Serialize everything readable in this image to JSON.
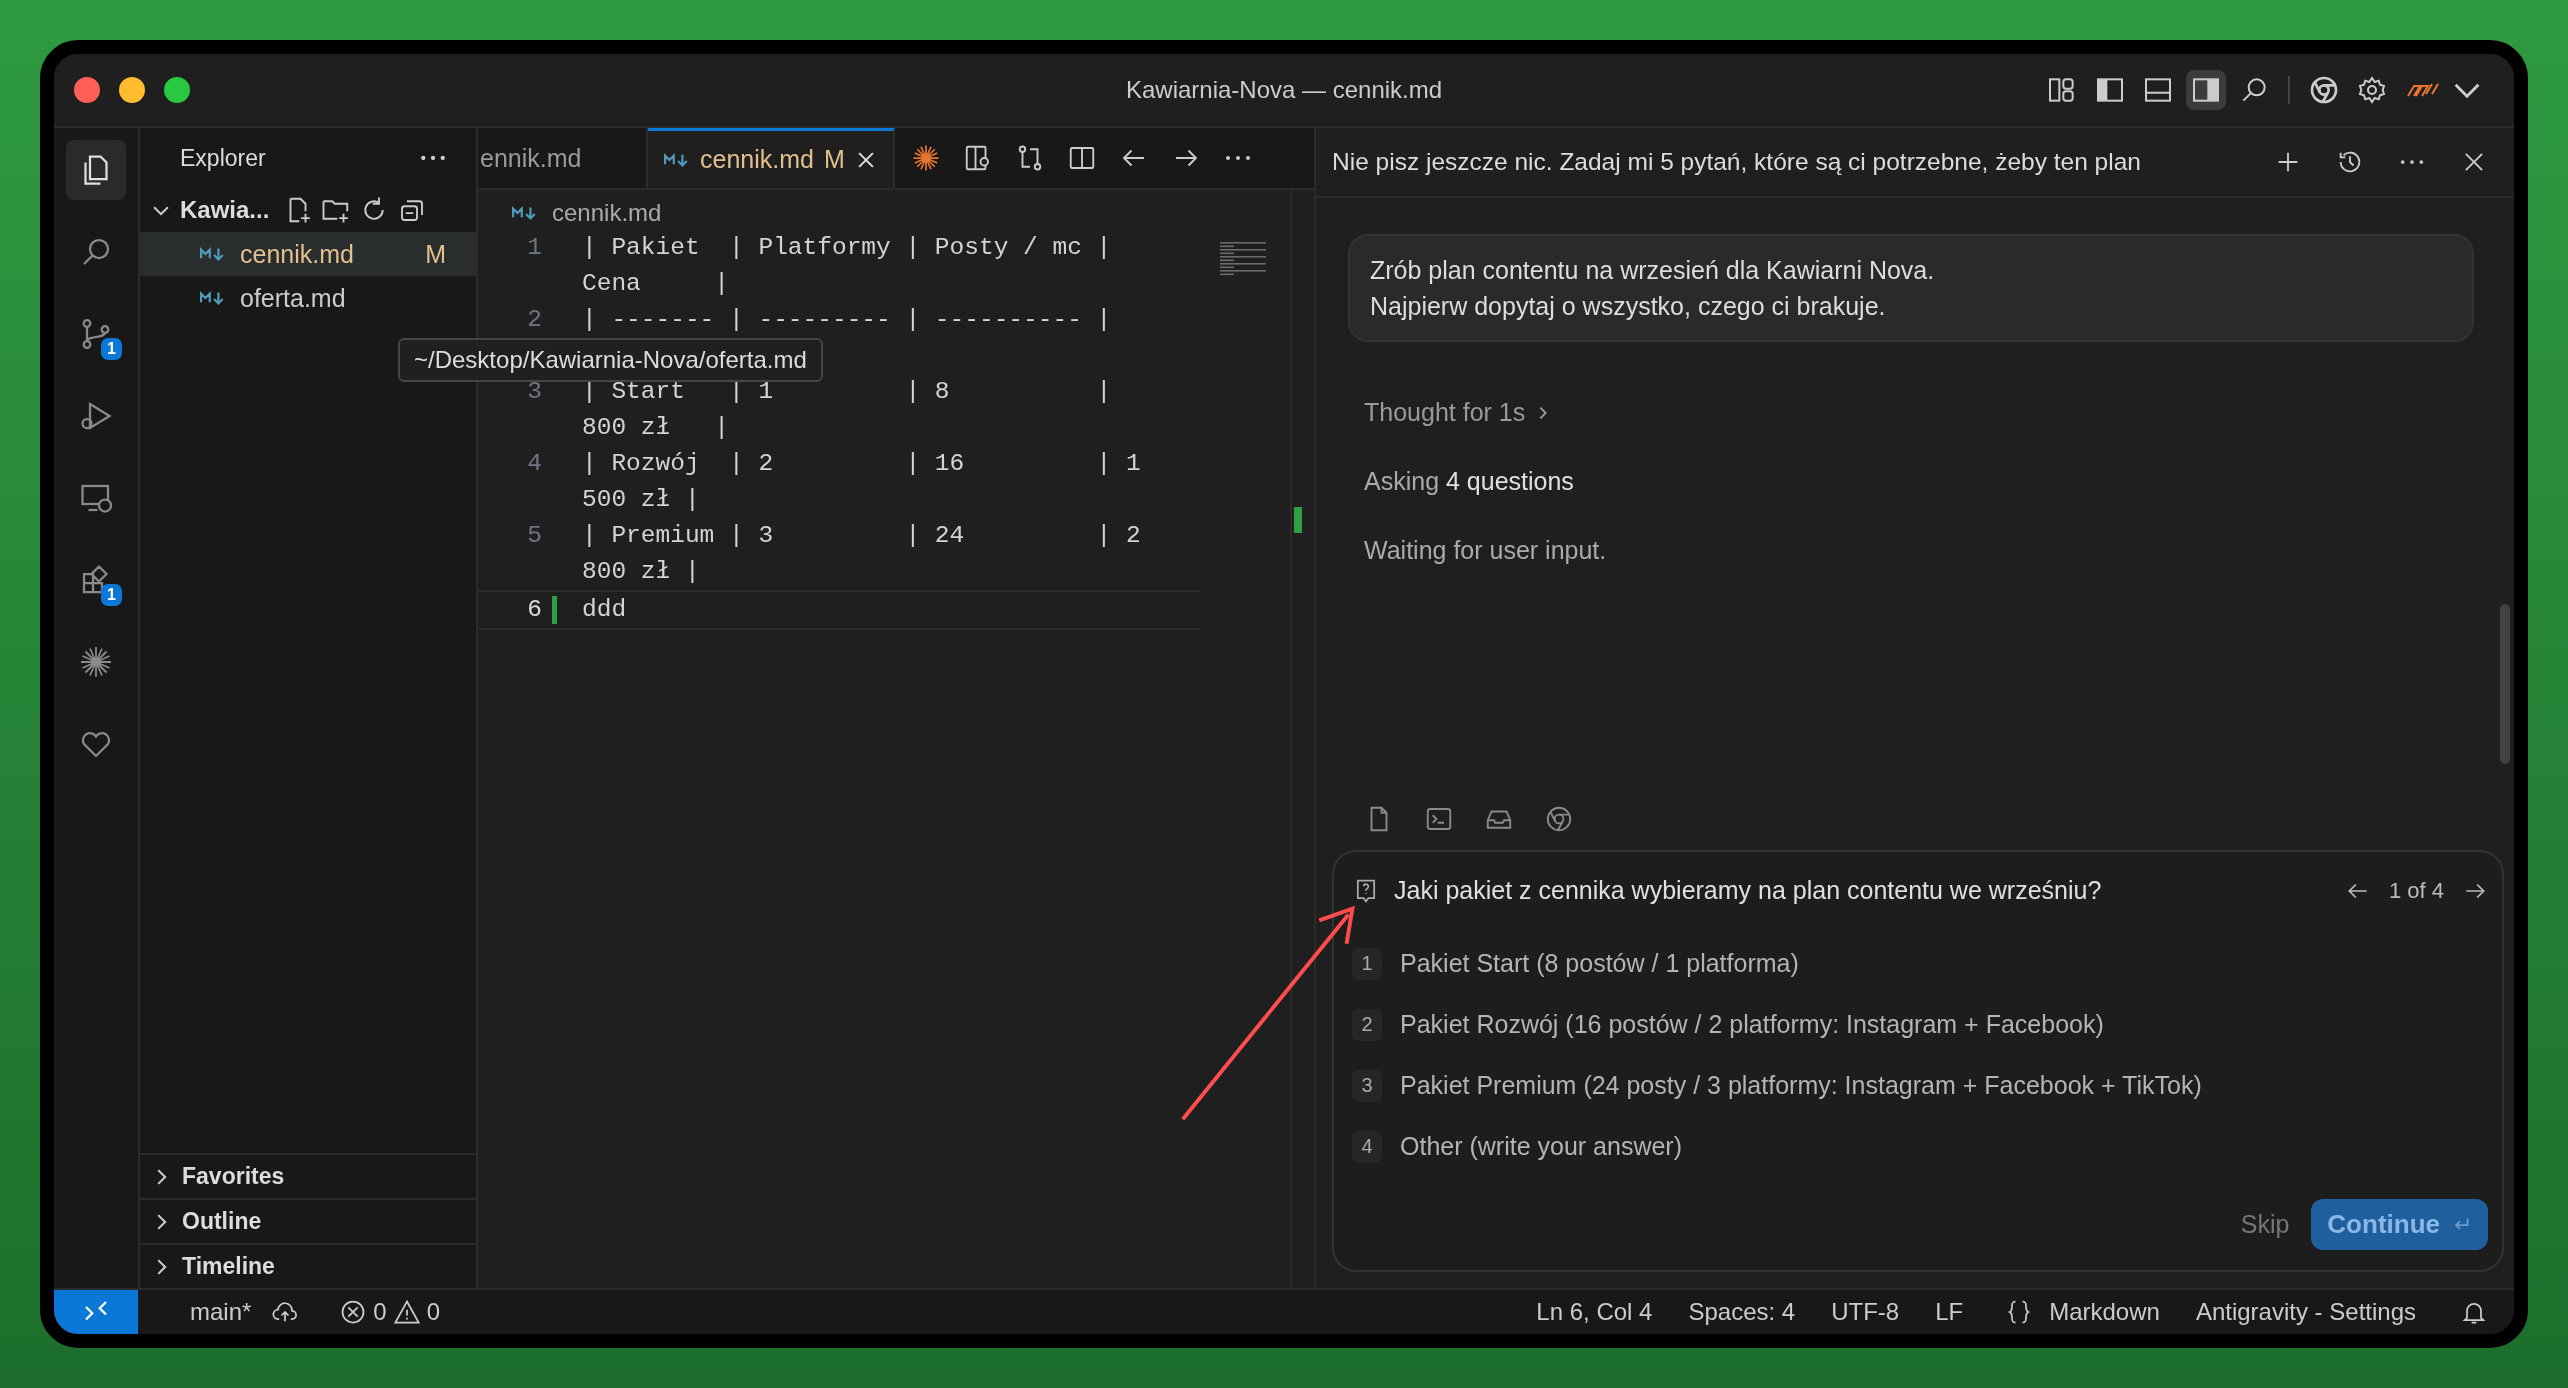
{
  "window": {
    "title": "Kawiarnia-Nova — cennik.md"
  },
  "title_actions": [
    {
      "kind": "layout",
      "selected": false
    },
    {
      "kind": "sidebar",
      "selected": false
    },
    {
      "kind": "panel",
      "selected": false
    },
    {
      "kind": "aux",
      "selected": true
    },
    {
      "kind": "search",
      "selected": false
    },
    {
      "kind": "browser",
      "selected": false
    },
    {
      "kind": "settings",
      "selected": false
    },
    {
      "kind": "logo",
      "selected": false
    }
  ],
  "activity_bar": [
    {
      "kind": "explorer",
      "selected": true
    },
    {
      "kind": "search",
      "selected": false
    },
    {
      "kind": "source-control",
      "selected": false,
      "badge": "1"
    },
    {
      "kind": "run",
      "selected": false
    },
    {
      "kind": "remote",
      "selected": false
    },
    {
      "kind": "extensions",
      "selected": false,
      "badge": "1"
    },
    {
      "kind": "agent",
      "selected": false
    },
    {
      "kind": "heart",
      "selected": false
    }
  ],
  "explorer": {
    "title": "Explorer",
    "folder": {
      "name": "Kawia...",
      "expanded": true
    },
    "files": [
      {
        "name": "cennik.md",
        "status": "M",
        "selected": true
      },
      {
        "name": "oferta.md",
        "selected": false
      }
    ],
    "tooltip": "~/Desktop/Kawiarnia-Nova/oferta.md",
    "sections": [
      {
        "label": "Favorites",
        "expanded": false
      },
      {
        "label": "Outline",
        "expanded": false
      },
      {
        "label": "Timeline",
        "expanded": false
      }
    ]
  },
  "editor": {
    "tabs": [
      {
        "label": "ennik.md",
        "selected": false
      },
      {
        "label": "cennik.md",
        "status": "M",
        "selected": true
      }
    ],
    "breadcrumb": "cennik.md",
    "lines": [
      {
        "number": "1",
        "text": "| Pakiet  | Platformy | Posty / mc | Cena     |",
        "current": false,
        "changed": false
      },
      {
        "number": "2",
        "text": "| ------- | --------- | ---------- |",
        "current": false,
        "changed": false,
        "continued": true
      },
      {
        "number": "3",
        "text": "| Start   | 1         | 8          | 800 zł   |",
        "current": false,
        "changed": false
      },
      {
        "number": "4",
        "text": "| Rozwój  | 2         | 16         | 1 500 zł |",
        "current": false,
        "changed": false
      },
      {
        "number": "5",
        "text": "| Premium | 3         | 24         | 2 800 zł |",
        "current": false,
        "changed": false
      },
      {
        "number": "6",
        "text": "ddd",
        "current": true,
        "changed": true
      }
    ]
  },
  "chat": {
    "title": "Nie pisz jeszcze nic. Zadaj mi 5 pytań, które są ci potrzebne, żeby ten plan",
    "user_message": [
      "Zrób plan contentu na wrzesień dla Kawiarni Nova.",
      "Najpierw dopytaj o wszystko, czego ci brakuje."
    ],
    "thought": "Thought for 1s",
    "status": "Asking **4 questions**",
    "waiting": "Waiting for user input.",
    "question": {
      "text": "Jaki pakiet z cennika wybieramy na plan contentu we wrześniu?",
      "pager": "1 of 4",
      "options": [
        {
          "number": "1",
          "label": "Pakiet Start (8 postów / 1 platforma)"
        },
        {
          "number": "2",
          "label": "Pakiet Rozwój (16 postów / 2 platformy: Instagram + Facebook)"
        },
        {
          "number": "3",
          "label": "Pakiet Premium (24 posty / 3 platformy: Instagram + Facebook + TikTok)"
        },
        {
          "number": "4",
          "label": "Other (write your answer)"
        }
      ],
      "skip": "Skip",
      "continue": "Continue",
      "continue_key": "↵"
    }
  },
  "status_bar": {
    "branch": "main*",
    "errors": "0",
    "warnings": "0",
    "items": [
      "Ln 6, Col 4",
      "Spaces: 4",
      "UTF-8",
      "LF",
      "Markdown",
      "Antigravity - Settings"
    ]
  }
}
